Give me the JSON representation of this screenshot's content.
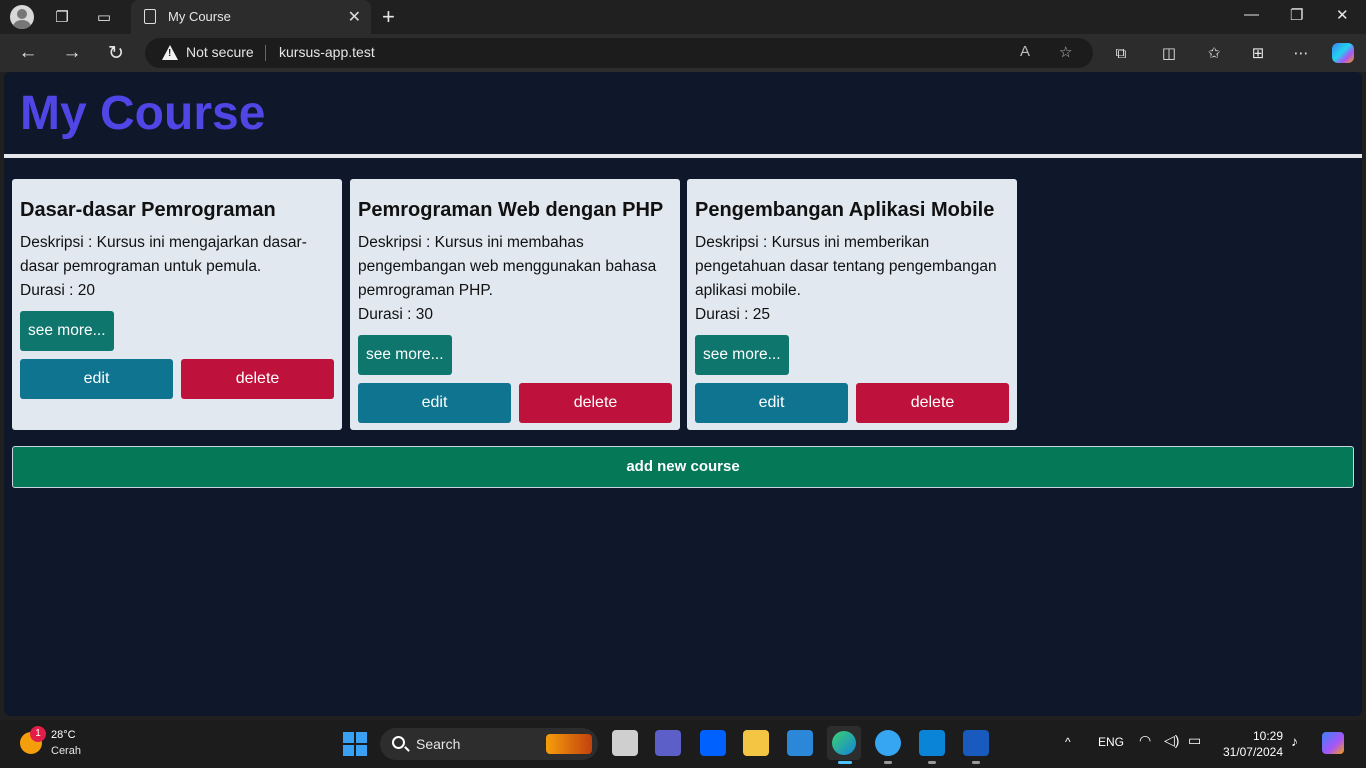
{
  "browser": {
    "tab_title": "My Course",
    "security_label": "Not secure",
    "url": "kursus-app.test"
  },
  "page": {
    "title": "My Course",
    "courses": [
      {
        "title": "Dasar-dasar Pemrograman",
        "description": "Deskripsi : Kursus ini mengajarkan dasar-dasar pemrograman untuk pemula.",
        "duration": "Durasi : 20",
        "more_label": "see more...",
        "edit_label": "edit",
        "delete_label": "delete"
      },
      {
        "title": "Pemrograman Web dengan PHP",
        "description": "Deskripsi : Kursus ini membahas pengembangan web menggunakan bahasa pemrograman PHP.",
        "duration": "Durasi : 30",
        "more_label": "see more...",
        "edit_label": "edit",
        "delete_label": "delete"
      },
      {
        "title": "Pengembangan Aplikasi Mobile",
        "description": "Deskripsi : Kursus ini memberikan pengetahuan dasar tentang pengembangan aplikasi mobile.",
        "duration": "Durasi : 25",
        "more_label": "see more...",
        "edit_label": "edit",
        "delete_label": "delete"
      }
    ],
    "add_label": "add new course"
  },
  "taskbar": {
    "weather_badge": "1",
    "temperature": "28°C",
    "condition": "Cerah",
    "search_label": "Search",
    "language": "ENG",
    "time": "10:29",
    "date": "31/07/2024"
  },
  "colors": {
    "page_bg": "#0f172a",
    "title": "#4f46e5",
    "card_bg": "#e2e8f0",
    "more_button": "#0f766e",
    "edit_button": "#0e7490",
    "delete_button": "#be123c",
    "add_button": "#047857"
  }
}
